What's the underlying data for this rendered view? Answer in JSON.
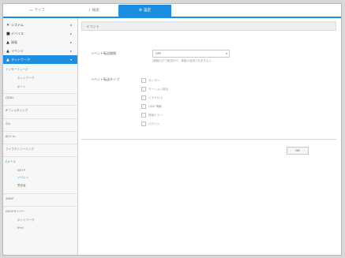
{
  "tabs": [
    {
      "label": "ライブ",
      "icon": "monitor-icon",
      "glyph": "▭"
    },
    {
      "label": "検索",
      "icon": "search-icon",
      "glyph": "⌕"
    },
    {
      "label": "設定",
      "icon": "gear-icon",
      "glyph": "⚙"
    }
  ],
  "sidebar": {
    "main_items": [
      {
        "label": "システム",
        "icon": "tools-icon",
        "glyph": "✕"
      },
      {
        "label": "デバイス",
        "icon": "camera-icon",
        "glyph": "■"
      },
      {
        "label": "録画",
        "icon": "record-icon",
        "glyph": "▲"
      },
      {
        "label": "イベント",
        "icon": "event-icon",
        "glyph": "▲"
      },
      {
        "label": "ネットワーク",
        "icon": "network-icon",
        "glyph": "▲"
      }
    ],
    "tree": [
      {
        "label": "インターフェース",
        "type": "group"
      },
      {
        "label": "ネットワーク",
        "type": "child"
      },
      {
        "label": "ポート",
        "type": "child"
      },
      {
        "label": "DDNS",
        "type": "group"
      },
      {
        "label": "IPフィルタリング",
        "type": "group"
      },
      {
        "label": "SSL",
        "type": "group"
      },
      {
        "label": "802.1x",
        "type": "group"
      },
      {
        "label": "ライブストリーミング",
        "type": "group"
      },
      {
        "label": "Eメール",
        "type": "group-active"
      },
      {
        "label": "SMTP",
        "type": "child"
      },
      {
        "label": "イベント",
        "type": "child-active"
      },
      {
        "label": "受信者",
        "type": "child"
      },
      {
        "label": "SNMP",
        "type": "group"
      },
      {
        "label": "DHCPサーバー",
        "type": "group"
      },
      {
        "label": "ネットワーク",
        "type": "child"
      },
      {
        "label": "IPv6",
        "type": "child"
      }
    ]
  },
  "content": {
    "section_title": "イベント",
    "interval_label": "イベント転送間隔",
    "interval_value": "OFF",
    "interval_note": "(録画ログで転送(ISC、重複の活用されません))",
    "event_type_label": "イベント転送タイプ",
    "event_types": [
      "センサー",
      "モーション検出",
      "ビデオロス",
      "HDD 情報",
      "録画エラー",
      "ログイン"
    ],
    "ok_label": "OK"
  },
  "colors": {
    "accent": "#1e8fe0"
  }
}
